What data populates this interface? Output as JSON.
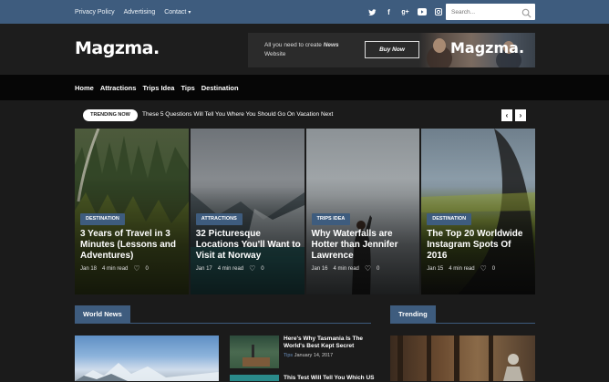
{
  "topbar": {
    "links": [
      "Privacy Policy",
      "Advertising",
      "Contact"
    ],
    "social_icons": [
      "twitter-icon",
      "facebook-icon",
      "google-plus-icon",
      "youtube-icon",
      "instagram-icon"
    ],
    "search_placeholder": "Search..."
  },
  "header": {
    "logo": "Magzma.",
    "ad": {
      "text_prefix": "All you need to create ",
      "text_bold": "News",
      "text_suffix": " Website",
      "button": "Buy Now",
      "logo": "Magzma."
    }
  },
  "nav": {
    "items": [
      "Home",
      "Attractions",
      "Trips Idea",
      "Tips",
      "Destination"
    ]
  },
  "trending": {
    "label": "TRENDING NOW",
    "headline": "These 5 Questions Will Tell You Where You Should Go On Vacation Next",
    "prev": "‹",
    "next": "›"
  },
  "cards": [
    {
      "category": "DESTINATION",
      "title": "3 Years of Travel in 3 Minutes (Lessons and Adventures)",
      "date": "Jan 18",
      "read": "4 min read",
      "likes": "0"
    },
    {
      "category": "ATTRACTIONS",
      "title": "32 Picturesque Locations You'll Want to Visit at Norway",
      "date": "Jan 17",
      "read": "4 min read",
      "likes": "0"
    },
    {
      "category": "TRIPS IDEA",
      "title": "Why Waterfalls are Hotter than Jennifer Lawrence",
      "date": "Jan 16",
      "read": "4 min read",
      "likes": "0"
    },
    {
      "category": "DESTINATION",
      "title": "The Top 20 Worldwide Instagram Spots Of 2016",
      "date": "Jan 15",
      "read": "4 min read",
      "likes": "0"
    }
  ],
  "world_news": {
    "label": "World News",
    "items": [
      {
        "title": "Here's Why Tasmania Is The World's Best Kept Secret",
        "cat": "Tips",
        "date": "January 14, 2017"
      },
      {
        "title": "This Test Will Tell You Which US",
        "cat": "",
        "date": ""
      }
    ]
  },
  "trending_section": {
    "label": "Trending"
  },
  "colors": {
    "accent": "#3e5c7e",
    "background": "#1b1b1b",
    "nav": "#060606"
  }
}
